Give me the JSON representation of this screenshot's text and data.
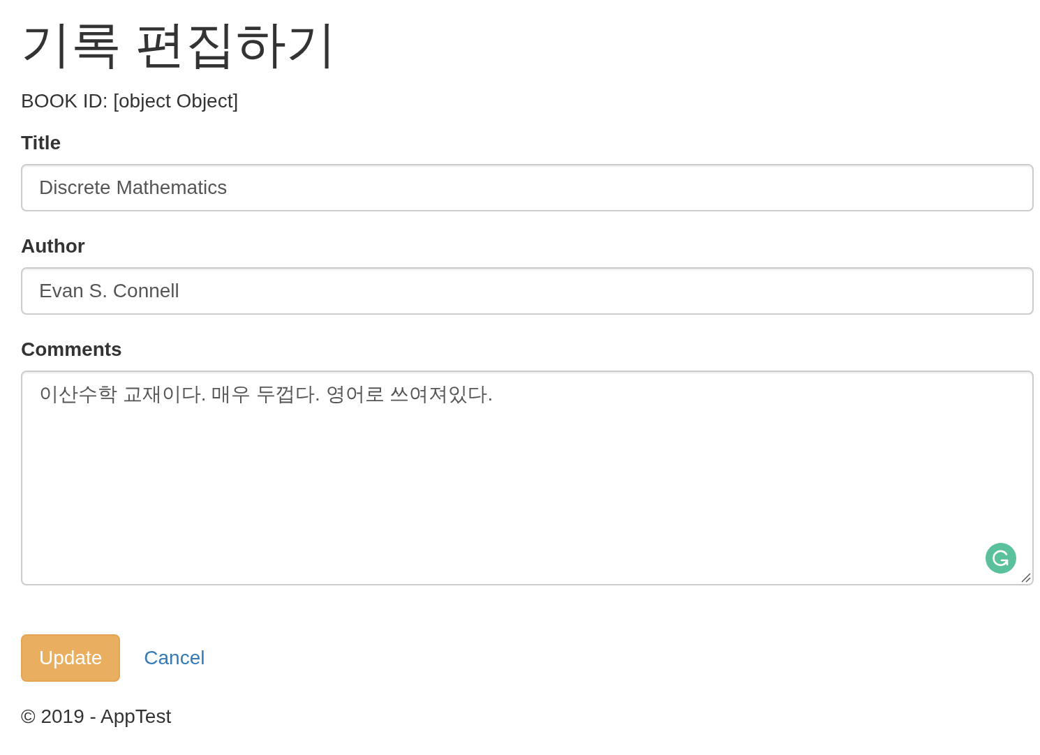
{
  "page": {
    "heading": "기록 편집하기",
    "book_id": "BOOK ID: [object Object]"
  },
  "form": {
    "fields": [
      {
        "kind": "input",
        "label": "Title",
        "value": "Discrete Mathematics"
      },
      {
        "kind": "input",
        "label": "Author",
        "value": "Evan S. Connell"
      },
      {
        "kind": "textarea",
        "label": "Comments",
        "value": "이산수학 교재이다. 매우 두껍다. 영어로 쓰여져있다."
      }
    ],
    "actions": [
      {
        "kind": "primary",
        "label": "Update"
      },
      {
        "kind": "link",
        "label": "Cancel"
      }
    ]
  },
  "footer": {
    "text": "© 2019 - AppTest"
  }
}
